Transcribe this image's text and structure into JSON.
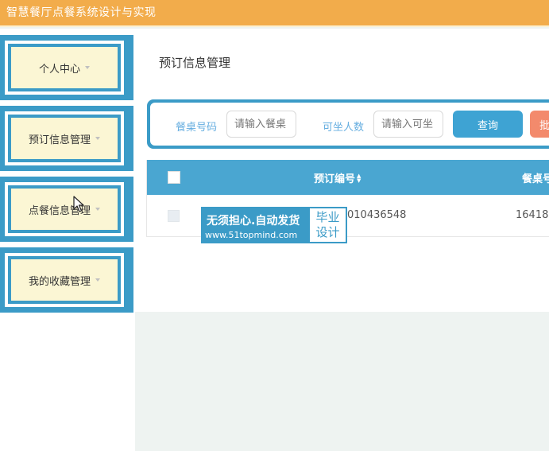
{
  "app": {
    "title": "智慧餐厅点餐系统设计与实现"
  },
  "sidebar": {
    "items": [
      {
        "label": "个人中心"
      },
      {
        "label": "预订信息管理"
      },
      {
        "label": "点餐信息管理"
      },
      {
        "label": "我的收藏管理"
      }
    ]
  },
  "main": {
    "page_title": "预订信息管理",
    "search": {
      "table_no_label": "餐桌号码",
      "table_no_placeholder": "请输入餐桌",
      "seats_label": "可坐人数",
      "seats_placeholder": "请输入可坐",
      "query_label": "查询",
      "batch_label": "批"
    },
    "table": {
      "columns": [
        "预订编号",
        "餐桌号"
      ],
      "rows": [
        {
          "order_no": "010436548",
          "table_no": "16418"
        }
      ]
    }
  },
  "watermark": {
    "line1": "无须担心.自动发货",
    "line2": "www.51topmind.com",
    "right1": "毕业",
    "right2": "设计"
  },
  "colors": {
    "topbar": "#f2ac4b",
    "accent": "#3b9bc7",
    "menu_fill": "#fbf6d4",
    "batch": "#f38a6c"
  }
}
